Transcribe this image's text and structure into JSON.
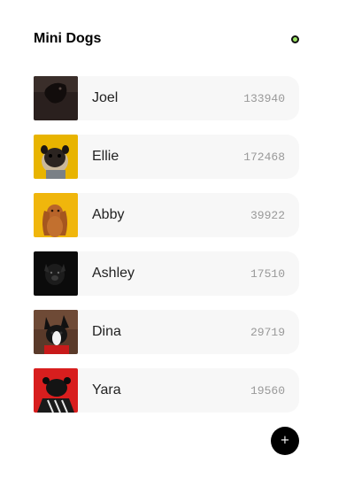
{
  "header": {
    "title": "Mini Dogs",
    "status_dot_color": "#9be564"
  },
  "dogs": [
    {
      "name": "Joel",
      "count": "133940",
      "avatar_bg": "#2a201e"
    },
    {
      "name": "Ellie",
      "count": "172468",
      "avatar_bg": "#e8b400"
    },
    {
      "name": "Abby",
      "count": "39922",
      "avatar_bg": "#f0b60c"
    },
    {
      "name": "Ashley",
      "count": "17510",
      "avatar_bg": "#0b0b0b"
    },
    {
      "name": "Dina",
      "count": "29719",
      "avatar_bg": "#5a3a2a"
    },
    {
      "name": "Yara",
      "count": "19560",
      "avatar_bg": "#d81e1e"
    }
  ],
  "add_button": {
    "label": "+",
    "icon": "plus-icon"
  }
}
